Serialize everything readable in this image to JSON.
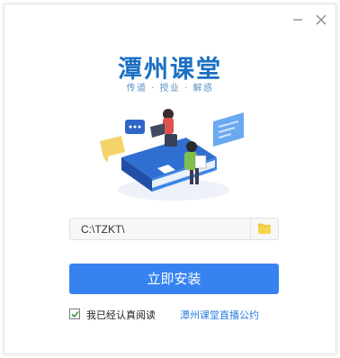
{
  "window": {
    "minimize_icon": "minimize-icon",
    "close_icon": "close-icon"
  },
  "brand": {
    "title": "潭州课堂",
    "slogan": "传道 · 授业 · 解惑",
    "title_color": "#1a6fc4"
  },
  "install": {
    "path_value": "C:\\TZKT\\",
    "browse_icon": "folder-icon",
    "install_label": "立即安装",
    "button_color": "#3683f0"
  },
  "agreement": {
    "checked": true,
    "text": "我已经认真阅读",
    "link": "潭州课堂直播公约"
  }
}
